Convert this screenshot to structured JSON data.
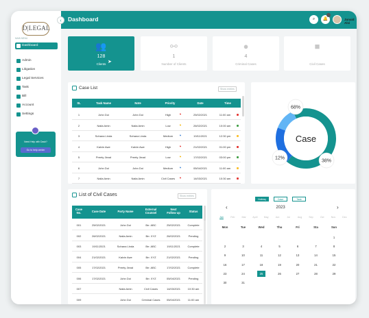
{
  "app": {
    "logo_text": "D|LEGAL",
    "sidebar_label": "MAIN MENU",
    "title": "Dashboard",
    "user": "Junaid Alvi"
  },
  "sidebar": {
    "items": [
      {
        "label": "Dashboard",
        "active": true
      },
      {
        "label": "Admin"
      },
      {
        "label": "Litigation"
      },
      {
        "label": "Legal Services"
      },
      {
        "label": "Task"
      },
      {
        "label": "Bill"
      },
      {
        "label": "Account"
      },
      {
        "label": "Settings"
      }
    ],
    "help": {
      "text": "Need Help with Dash?",
      "button": "Go to help center"
    }
  },
  "cards": [
    {
      "value": "128",
      "label": "Clients",
      "icon": "people-icon",
      "active": true
    },
    {
      "value": "1",
      "label": "Number of Clients",
      "icon": "link-icon"
    },
    {
      "value": "4",
      "label": "Criminal Cases",
      "icon": "alert-icon"
    },
    {
      "value": "",
      "label": "Civil Cases",
      "icon": "check-icon"
    }
  ],
  "case_list": {
    "title": "Case List",
    "show": "Show entries",
    "headers": [
      "SL",
      "Task Name",
      "Note",
      "Priority",
      "Date",
      "Time"
    ],
    "rows": [
      [
        "1",
        "John Doi",
        "John Doi",
        "High",
        "25/02/2021",
        "11:00 am"
      ],
      [
        "2",
        "Naila Amin",
        "Naila Amin",
        "Low",
        "26/02/2021",
        "10:00 am"
      ],
      [
        "3",
        "Sohana Linda",
        "Sohana Linda",
        "Medium",
        "19/11/2021",
        "12:30 pm"
      ],
      [
        "4",
        "Kalvin Awe",
        "Kalvin Awe",
        "High",
        "21/02/2021",
        "01:00 pm"
      ],
      [
        "5",
        "Preety Jiead",
        "Preety Jiead",
        "Low",
        "17/02/2021",
        "03:00 pm"
      ],
      [
        "6",
        "John Doi",
        "John Doi",
        "Medium",
        "05/04/2021",
        "11:00 am"
      ],
      [
        "7",
        "Naila Amin",
        "Naila Amin",
        "Civil Cases",
        "14/03/2021",
        "10:30 am"
      ]
    ],
    "colors": {
      "High": "#e53935",
      "Low": "#43a047",
      "Medium": "#fbc02d",
      "Civil Cases": "#e53935"
    },
    "flags": {
      "High": "#e53935",
      "Low": "#f4b400",
      "Medium": "#4a8bd6",
      "Civil Cases": "#e53935"
    }
  },
  "chart_data": {
    "type": "pie",
    "title": "Case",
    "slices": [
      {
        "label": "68%",
        "value": 68,
        "color": "#14938f"
      },
      {
        "label": "38%",
        "value": 20,
        "color": "#1f6fe0"
      },
      {
        "label": "12%",
        "value": 12,
        "color": "#62b5f5"
      }
    ],
    "labels": [
      "68%",
      "38%",
      "12%"
    ]
  },
  "civil_cases": {
    "title": "List of Civil Cases",
    "show": "Show entries",
    "headers": [
      [
        "Case",
        "No."
      ],
      [
        "Case Date"
      ],
      [
        "Party Name"
      ],
      [
        "External",
        "Counsel"
      ],
      [
        "Next",
        "Follow up"
      ],
      [
        "Status"
      ]
    ],
    "rows": [
      [
        "001",
        "25/02/2021",
        "John Doi",
        "Brr. ABC",
        "25/02/2021",
        "Complete"
      ],
      [
        "002",
        "26/02/2021",
        "Naila Amin",
        "Brr. XYZ",
        "26/02/2021",
        "Pending"
      ],
      [
        "003",
        "19/11/2021",
        "Sohana Linda",
        "Brr. ABC",
        "19/11/2021",
        "Complete"
      ],
      [
        "004",
        "21/02/2021",
        "Kalvin Awe",
        "Brr. XYZ",
        "21/02/2021",
        "Pending"
      ],
      [
        "005",
        "17/02/2021",
        "Preety Jiead",
        "Brr. ABC",
        "17/02/2021",
        "Complete"
      ],
      [
        "006",
        "17/02/2021",
        "John Doi",
        "Brr. XYZ",
        "05/04/2021",
        "Pending"
      ],
      [
        "007",
        "",
        "Naila Amin",
        "Civil Cases",
        "14/03/2021",
        "10:30 am"
      ],
      [
        "009",
        "",
        "John Doi",
        "Criminal Cases",
        "05/04/2021",
        "11:00 am"
      ]
    ]
  },
  "calendar": {
    "tabs": [
      "Holiday",
      "Case",
      "Task"
    ],
    "active_tab": "Holiday",
    "prev": "‹",
    "next": "›",
    "year": "2023",
    "months": [
      "Jan",
      "Feb",
      "Mar",
      "April",
      "May",
      "Jun",
      "Jul",
      "Aug",
      "Sep",
      "Oct",
      "Nov",
      "Dec"
    ],
    "selected_month": "Jan",
    "weekdays": [
      "Mon",
      "Tue",
      "Wed",
      "Thu",
      "Fri",
      "Sta",
      "Sun"
    ],
    "days": [
      "1",
      "2",
      "3",
      "4",
      "5",
      "6",
      "7",
      "8",
      "9",
      "10",
      "11",
      "12",
      "13",
      "14",
      "15",
      "16",
      "17",
      "18",
      "19",
      "20",
      "21",
      "22",
      "23",
      "24",
      "25",
      "26",
      "27",
      "28",
      "29",
      "30",
      "31"
    ],
    "first_col": 6,
    "today": "25"
  }
}
